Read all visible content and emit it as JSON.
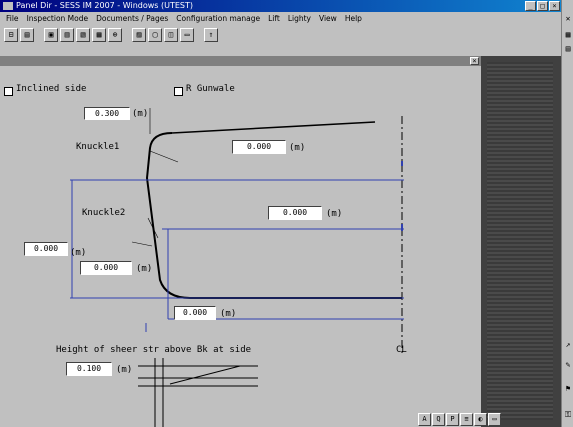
{
  "window": {
    "title": "Panel Dir - SESS IM 2007 - Windows (UTEST)"
  },
  "menu": [
    "File",
    "Inspection Mode",
    "Documents / Pages",
    "Configuration manage",
    "Lift",
    "Lighty",
    "View",
    "Help"
  ],
  "toolbar": [
    "⊟",
    "▤",
    "▣",
    "▥",
    "▧",
    "▦",
    "⊕",
    "▨",
    "▢",
    "◫",
    "▭",
    "⇑"
  ],
  "form": {
    "inclined_side_label": "Inclined side",
    "r_gunwale_label": "R Gunwale",
    "knuckle1_label": "Knuckle1",
    "knuckle2_label": "Knuckle2",
    "unit_m": "(m)",
    "centerline_label": "CL",
    "height_label": "Height of sheer str above Bk at side",
    "fields": {
      "top_offset": "0.300",
      "knuckle1_width": "0.000",
      "knuckle2_width": "0.000",
      "depth": "0.000",
      "bilge_height": "0.000",
      "bottom_width": "0.000",
      "sheer_height": "0.100"
    }
  },
  "taskbar": [
    "A",
    "Q",
    "P",
    "≡",
    "◐",
    "▭"
  ]
}
